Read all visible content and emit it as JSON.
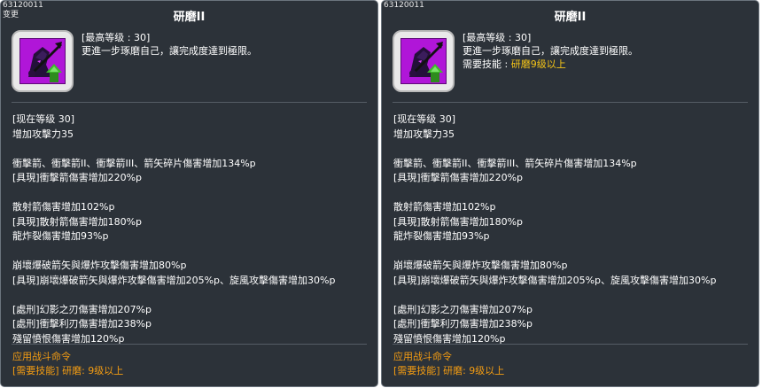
{
  "left_panel": {
    "code": "63120011",
    "tag": "变更",
    "title": "研磨II",
    "max_level": "[最高等级 : 30]",
    "description": "更進一步琢磨自己，讓完成度達到極限。",
    "current_level": "[现在等级 30]",
    "lines": [
      "增加攻擊力35",
      "",
      "衝擊箭、衝擊箭II、衝擊箭III、箭矢碎片傷害增加134%p",
      "[具現]衝擊箭傷害增加220%p",
      "",
      "散射箭傷害增加102%p",
      "[具現]散射箭傷害增加180%p",
      "龍炸裂傷害增加93%p",
      "",
      "崩壞爆破箭矢與爆炸攻擊傷害增加80%p",
      "[具現]崩壞爆破箭矢與爆炸攻擊傷害增加205%p、旋風攻擊傷害增加30%p",
      "",
      "[處刑]幻影之刃傷害增加207%p",
      "[處刑]衝擊利刃傷害增加238%p",
      "殘留憤恨傷害增加120%p"
    ],
    "footer_line1": "应用战斗命令",
    "footer_line2": "[需要技能] 研磨: 9级以上"
  },
  "right_panel": {
    "code": "63120011",
    "title": "研磨II",
    "max_level": "[最高等级 : 30]",
    "description": "更進一步琢磨自己，讓完成度達到極限。",
    "req_label": "需要技能 : ",
    "req_value": "研磨9级以上",
    "current_level": "[现在等级 30]",
    "lines": [
      "增加攻擊力35",
      "",
      "衝擊箭、衝擊箭II、衝擊箭III、箭矢碎片傷害增加134%p",
      "[具現]衝擊箭傷害增加220%p",
      "",
      "散射箭傷害增加102%p",
      "[具現]散射箭傷害增加180%p",
      "龍炸裂傷害增加93%p",
      "",
      "崩壞爆破箭矢與爆炸攻擊傷害增加80%p",
      "[具現]崩壞爆破箭矢與爆炸攻擊傷害增加205%p、旋風攻擊傷害增加30%p",
      "",
      "[處刑]幻影之刃傷害增加207%p",
      "[處刑]衝擊利刃傷害增加238%p",
      "殘留憤恨傷害增加120%p"
    ],
    "footer_line1": "应用战斗命令",
    "footer_line2": "[需要技能] 研磨: 9级以上"
  },
  "icons": {
    "skill_icon": "hooded-archer-skill-icon",
    "upgrade_arrow": "green-up-arrow-icon"
  },
  "colors": {
    "panel_bg": "#2c3239",
    "text": "#ffffff",
    "requirement": "#f5c518",
    "footer": "#f39c12",
    "icon_purple": "#b016d8"
  }
}
